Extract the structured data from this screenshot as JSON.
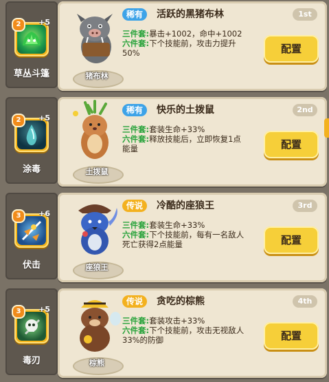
{
  "rows": [
    {
      "skill": {
        "name": "草丛斗篷",
        "level": "2",
        "plus": "+5",
        "icon": "bush-cloak-icon"
      },
      "pet": {
        "name": "猪布林",
        "rarity": "稀有",
        "title": "活跃的黑猪布林",
        "rank": "1st"
      },
      "set3_label": "三件套:",
      "set3_text": "暴击+1002，命中+1002",
      "set6_label": "六件套:",
      "set6_text": "下个技能前，攻击力提升50%",
      "button": "配置"
    },
    {
      "skill": {
        "name": "涂毒",
        "level": "2",
        "plus": "+5",
        "icon": "poison-drop-icon"
      },
      "pet": {
        "name": "土拨鼠",
        "rarity": "稀有",
        "title": "快乐的土拨鼠",
        "rank": "2nd"
      },
      "set3_label": "三件套:",
      "set3_text": "套装生命+33%",
      "set6_label": "六件套:",
      "set6_text": "释放技能后，立即恢复1点能量",
      "button": "配置"
    },
    {
      "skill": {
        "name": "伏击",
        "level": "3",
        "plus": "+6",
        "icon": "ambush-icon"
      },
      "pet": {
        "name": "座狼王",
        "rarity": "传说",
        "title": "冷酷的座狼王",
        "rank": "3rd"
      },
      "set3_label": "三件套:",
      "set3_text": "套装生命+33%",
      "set6_label": "六件套:",
      "set6_text": "下个技能前，每有一名敌人死亡获得2点能量",
      "button": "配置"
    },
    {
      "skill": {
        "name": "毒刃",
        "level": "3",
        "plus": "+5",
        "icon": "poison-blade-skull-icon"
      },
      "pet": {
        "name": "棕熊",
        "rarity": "传说",
        "title": "贪吃的棕熊",
        "rank": "4th"
      },
      "set3_label": "三件套:",
      "set3_text": "套装攻击+33%",
      "set6_label": "六件套:",
      "set6_text": "下个技能前，攻击无视敌人33%的防御",
      "button": "配置"
    }
  ],
  "colors": {
    "rare": "#3da3e8",
    "legend": "#f3b11f",
    "accent_green": "#27a23a",
    "button": "#f6cf39"
  }
}
